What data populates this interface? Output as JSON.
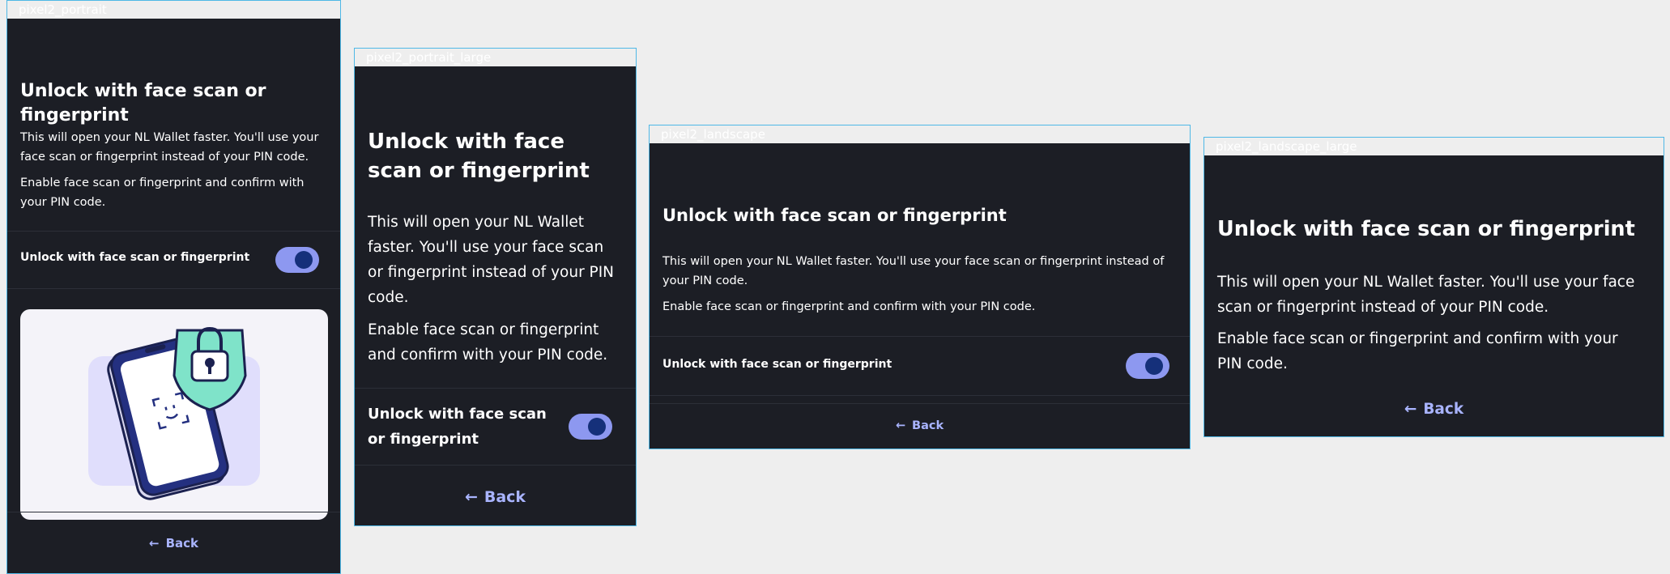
{
  "frames": [
    {
      "label": "pixel2_portrait"
    },
    {
      "label": "pixel2_portrait_large"
    },
    {
      "label": "pixel2_landscape"
    },
    {
      "label": "pixel2_landscape_large"
    }
  ],
  "screen": {
    "title": "Unlock with face scan or fingerprint",
    "description": "This will open your NL Wallet faster. You'll use your face scan or fingerprint instead of your PIN code.",
    "instruction": "Enable face scan or fingerprint and confirm with your PIN code.",
    "toggle_label": "Unlock with face scan or fingerprint",
    "toggle_on": true,
    "back_label": "Back"
  },
  "colors": {
    "background": "#1c1e25",
    "accent": "#a9b4ff",
    "toggle_track": "#8d98f0",
    "toggle_knob": "#15307a"
  },
  "icons": [
    "arrow-left-icon",
    "face-scan-icon",
    "lock-icon"
  ]
}
